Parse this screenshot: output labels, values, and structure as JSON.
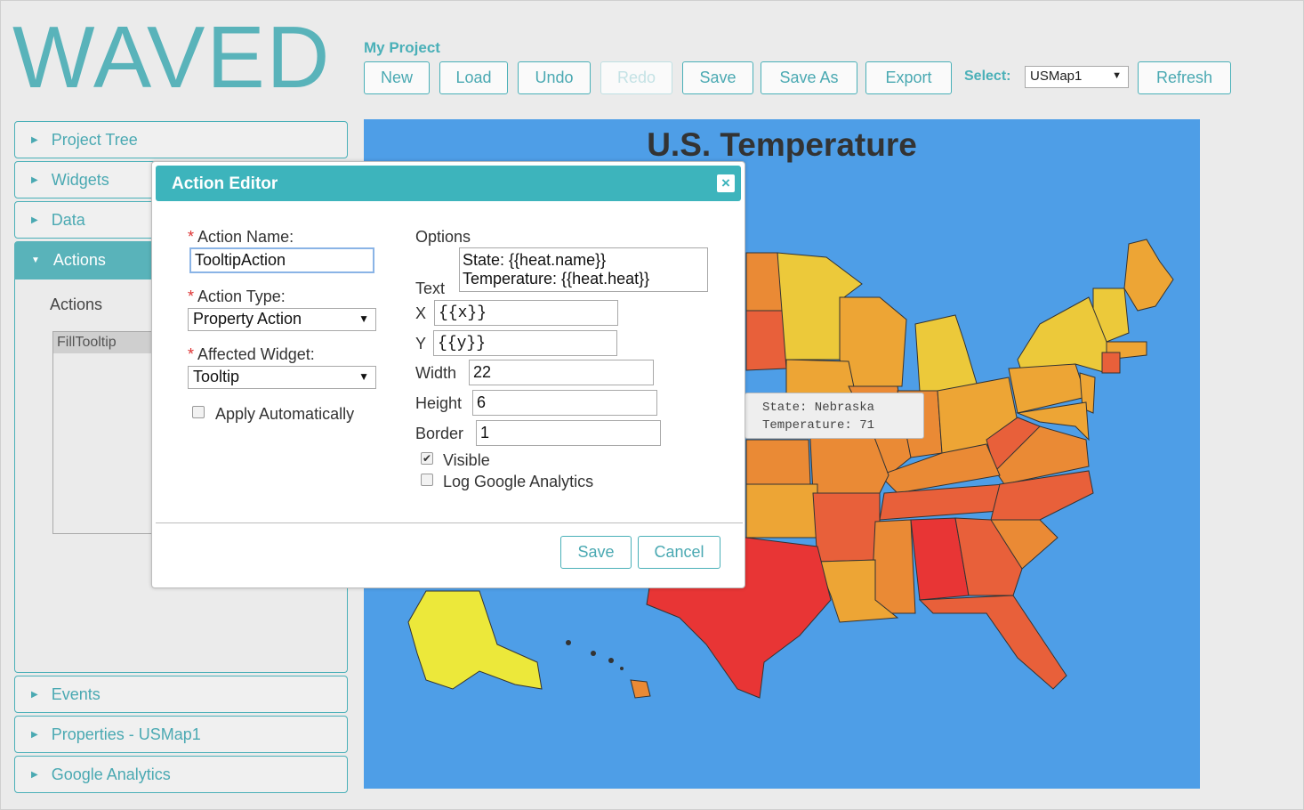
{
  "app": {
    "logo_text": "WAVED",
    "project_title": "My Project"
  },
  "toolbar": {
    "new": "New",
    "load": "Load",
    "undo": "Undo",
    "redo": "Redo",
    "save": "Save",
    "save_as": "Save As",
    "export": "Export",
    "select_label": "Select:",
    "select_value": "USMap1",
    "refresh": "Refresh"
  },
  "sidebar": {
    "sections": [
      {
        "label": "Project Tree",
        "expanded": false
      },
      {
        "label": "Widgets",
        "expanded": false
      },
      {
        "label": "Data",
        "expanded": false
      },
      {
        "label": "Actions",
        "expanded": true
      },
      {
        "label": "Events",
        "expanded": false
      },
      {
        "label": "Properties - USMap1",
        "expanded": false
      },
      {
        "label": "Google Analytics",
        "expanded": false
      }
    ],
    "actions_panel": {
      "label": "Actions",
      "items": [
        "FillTooltip"
      ]
    }
  },
  "map": {
    "title": "U.S. Temperature",
    "tooltip": {
      "line1": "State: Nebraska",
      "line2": "Temperature: 71"
    },
    "colors": {
      "background": "#4e9ee7",
      "hottest": "#e83535",
      "hot": "#e8603a",
      "warm": "#ea8a35",
      "mild": "#eda535",
      "cool": "#ecc93a",
      "coolest": "#ece83a"
    }
  },
  "modal": {
    "title": "Action Editor",
    "close_icon": "close-icon",
    "action_name_label": "Action Name:",
    "action_name_value": "TooltipAction",
    "action_type_label": "Action Type:",
    "action_type_value": "Property Action",
    "affected_widget_label": "Affected Widget:",
    "affected_widget_value": "Tooltip",
    "apply_auto_label": "Apply Automatically",
    "apply_auto_checked": false,
    "options_label": "Options",
    "text_label": "Text",
    "text_value": "State: {{heat.name}}\nTemperature: {{heat.heat}}",
    "x_label": "X",
    "x_value": "{{x}}",
    "y_label": "Y",
    "y_value": "{{y}}",
    "width_label": "Width",
    "width_value": "22",
    "height_label": "Height",
    "height_value": "6",
    "border_label": "Border",
    "border_value": "1",
    "visible_label": "Visible",
    "visible_checked": true,
    "log_ga_label": "Log Google Analytics",
    "log_ga_checked": false,
    "required_mark": "*",
    "save": "Save",
    "cancel": "Cancel"
  }
}
